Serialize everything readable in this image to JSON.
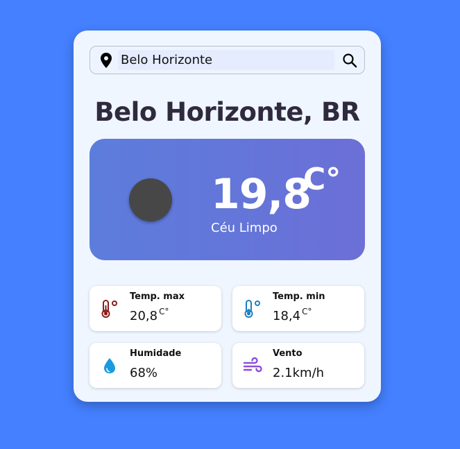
{
  "search": {
    "value": "Belo Horizonte",
    "pin_icon": "map-pin-icon",
    "button_icon": "search-icon"
  },
  "city": {
    "name": "Belo Horizonte, BR"
  },
  "current": {
    "temperature": "19,8",
    "unit": "C°",
    "condition": "Céu Limpo",
    "icon": "weather-icon"
  },
  "stats": {
    "temp_max": {
      "label": "Temp. max",
      "value": "20,8",
      "unit": "C°",
      "icon": "thermometer-hot-icon",
      "color": "#8c1c1c"
    },
    "temp_min": {
      "label": "Temp. min",
      "value": "18,4",
      "unit": "C°",
      "icon": "thermometer-cold-icon",
      "color": "#1d7fc4"
    },
    "humidity": {
      "label": "Humidade",
      "value": "68%",
      "icon": "water-drop-icon",
      "color": "#1a9be0"
    },
    "wind": {
      "label": "Vento",
      "value": "2.1km/h",
      "icon": "wind-icon",
      "color": "#8a4fdc"
    }
  },
  "colors": {
    "background": "#4480ff",
    "card": "#eff6ff",
    "hero_start": "#5c7ddc",
    "hero_end": "#6b6fd6"
  }
}
